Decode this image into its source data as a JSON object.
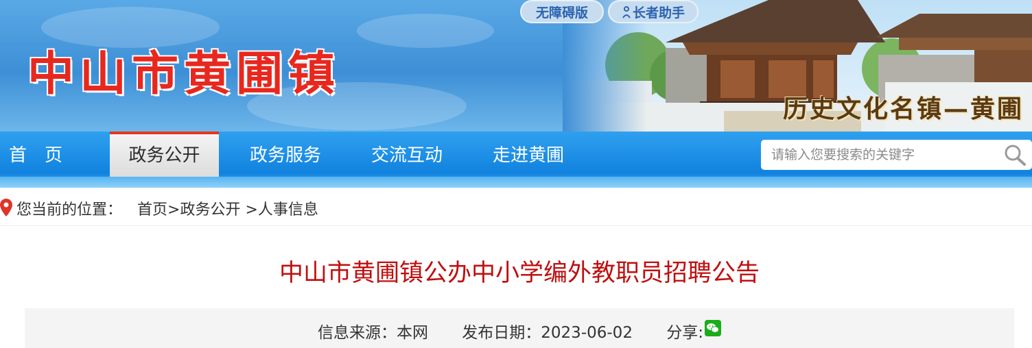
{
  "header": {
    "site_title": "中山市黄圃镇",
    "accessibility_label": "无障碍版",
    "elder_label": "长者助手",
    "slogan": "历史文化名镇—黄圃"
  },
  "nav": {
    "items": [
      {
        "label": "首　页"
      },
      {
        "label": "政务公开"
      },
      {
        "label": "政务服务"
      },
      {
        "label": "交流互动"
      },
      {
        "label": "走进黄圃"
      }
    ],
    "active_index": 1,
    "search_placeholder": "请输入您要搜索的关键字"
  },
  "breadcrumb": {
    "prefix": "您当前的位置：",
    "home": "首页",
    "sep1": ">",
    "section": "政务公开",
    "sep2": " >",
    "current": "人事信息"
  },
  "article": {
    "title": "中山市黄圃镇公办中小学编外教职员招聘公告",
    "source": "信息来源：本网",
    "date": "发布日期：2023-06-02",
    "share": "分享:"
  },
  "colors": {
    "title_red": "#c00f0f",
    "nav_blue": "#1182de",
    "site_title_red": "#e8281e"
  },
  "icons": [
    "elder-person-icon",
    "search-icon",
    "location-pin-icon",
    "wechat-icon"
  ]
}
